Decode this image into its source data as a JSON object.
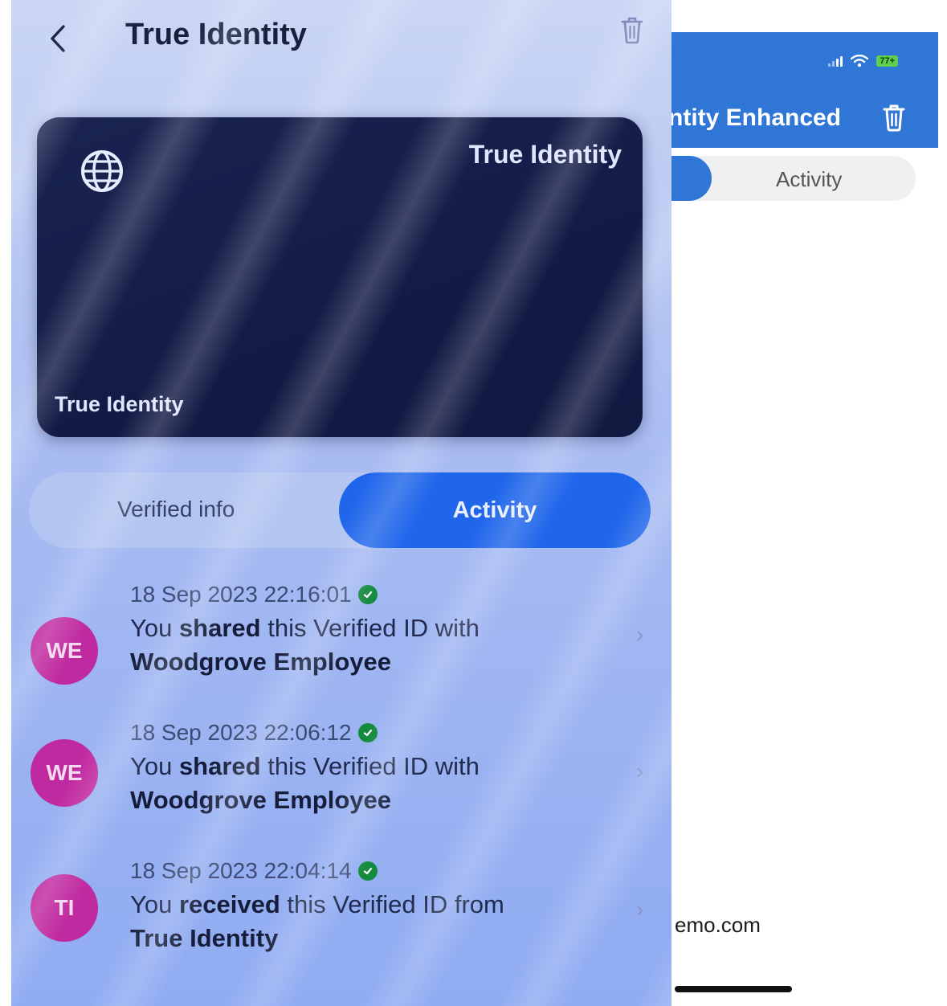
{
  "front": {
    "header": {
      "title": "True Identity",
      "back_icon": "chevron-left-icon",
      "trash_icon": "trash-icon"
    },
    "card": {
      "icon": "globe-icon",
      "title_top": "True Identity",
      "title_bottom": "True Identity",
      "color": "#131b45"
    },
    "tabs": [
      {
        "label": "Verified info",
        "active": false
      },
      {
        "label": "Activity",
        "active": true
      }
    ],
    "activity": [
      {
        "initials": "WE",
        "time": "18 Sep 2023 22:16:01",
        "prefix": "You ",
        "verb": "shared",
        "suffix": " this Verified ID with",
        "party": "Woodgrove Employee"
      },
      {
        "initials": "WE",
        "time": "18 Sep 2023 22:06:12",
        "prefix": "You ",
        "verb": "shared",
        "suffix": " this Verified ID with",
        "party": "Woodgrove Employee"
      },
      {
        "initials": "TI",
        "time": "18 Sep 2023 22:04:14",
        "prefix": "You ",
        "verb": "received",
        "suffix": " this Verified ID from",
        "party": "True Identity"
      }
    ],
    "accent_color": "#2066ea",
    "avatar_color": "#c02aa0",
    "verified_color": "#138a3c"
  },
  "back": {
    "status": {
      "battery": "77+"
    },
    "header": {
      "title": "ntity Enhanced"
    },
    "tab_activity": "Activity",
    "email_fragment": "emo.com",
    "header_color": "#2f76d6"
  }
}
